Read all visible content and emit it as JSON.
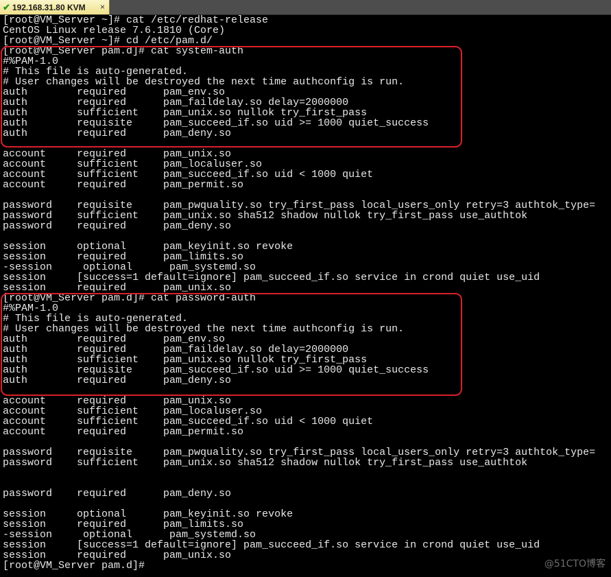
{
  "tab": {
    "title": "192.168.31.80 KVM",
    "close_label": "×"
  },
  "terminal": {
    "lines": [
      "[root@VM_Server ~]# cat /etc/redhat-release",
      "CentOS Linux release 7.6.1810 (Core)",
      "[root@VM_Server ~]# cd /etc/pam.d/",
      "[root@VM_Server pam.d]# cat system-auth",
      "#%PAM-1.0",
      "# This file is auto-generated.",
      "# User changes will be destroyed the next time authconfig is run.",
      "auth        required      pam_env.so",
      "auth        required      pam_faildelay.so delay=2000000",
      "auth        sufficient    pam_unix.so nullok try_first_pass",
      "auth        requisite     pam_succeed_if.so uid >= 1000 quiet_success",
      "auth        required      pam_deny.so",
      "",
      "account     required      pam_unix.so",
      "account     sufficient    pam_localuser.so",
      "account     sufficient    pam_succeed_if.so uid < 1000 quiet",
      "account     required      pam_permit.so",
      "",
      "password    requisite     pam_pwquality.so try_first_pass local_users_only retry=3 authtok_type=",
      "password    sufficient    pam_unix.so sha512 shadow nullok try_first_pass use_authtok",
      "password    required      pam_deny.so",
      "",
      "session     optional      pam_keyinit.so revoke",
      "session     required      pam_limits.so",
      "-session     optional      pam_systemd.so",
      "session     [success=1 default=ignore] pam_succeed_if.so service in crond quiet use_uid",
      "session     required      pam_unix.so",
      "[root@VM_Server pam.d]# cat password-auth",
      "#%PAM-1.0",
      "# This file is auto-generated.",
      "# User changes will be destroyed the next time authconfig is run.",
      "auth        required      pam_env.so",
      "auth        required      pam_faildelay.so delay=2000000",
      "auth        sufficient    pam_unix.so nullok try_first_pass",
      "auth        requisite     pam_succeed_if.so uid >= 1000 quiet_success",
      "auth        required      pam_deny.so",
      "",
      "account     required      pam_unix.so",
      "account     sufficient    pam_localuser.so",
      "account     sufficient    pam_succeed_if.so uid < 1000 quiet",
      "account     required      pam_permit.so",
      "",
      "password    requisite     pam_pwquality.so try_first_pass local_users_only retry=3 authtok_type=",
      "password    sufficient    pam_unix.so sha512 shadow nullok try_first_pass use_authtok",
      "",
      "",
      "password    required      pam_deny.so",
      "",
      "session     optional      pam_keyinit.so revoke",
      "session     required      pam_limits.so",
      "-session     optional      pam_systemd.so",
      "session     [success=1 default=ignore] pam_succeed_if.so service in crond quiet use_uid",
      "session     required      pam_unix.so",
      "[root@VM_Server pam.d]# "
    ]
  },
  "watermark": "@51CTO博客",
  "colors": {
    "background": "#000000",
    "foreground": "#e8e8e8",
    "highlight_box": "#d9202a",
    "tab_active": "#f3e9a6"
  }
}
